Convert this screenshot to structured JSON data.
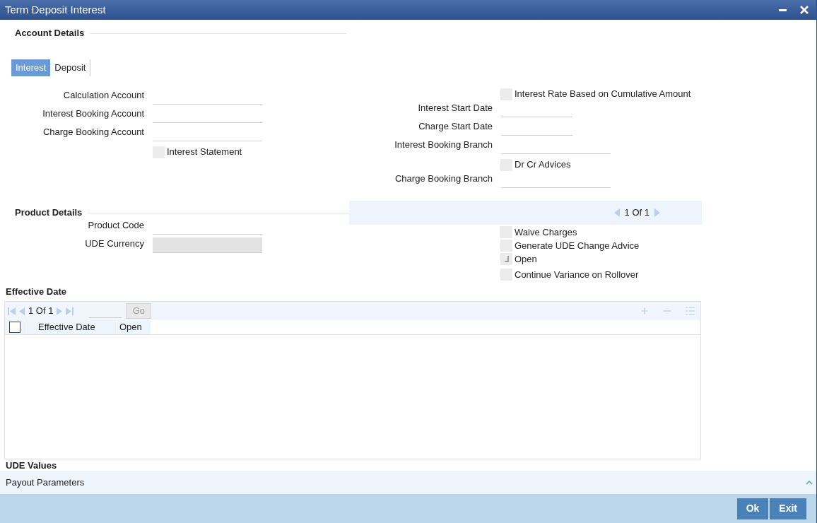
{
  "window": {
    "title": "Term Deposit Interest"
  },
  "account_details": {
    "heading": "Account Details",
    "tabs": [
      {
        "label": "Interest",
        "selected": true
      },
      {
        "label": "Deposit",
        "selected": false
      }
    ],
    "left_items": [
      {
        "kind": "field",
        "label": "Calculation Account"
      },
      {
        "kind": "field",
        "label": "Interest Booking Account"
      },
      {
        "kind": "field",
        "label": "Charge Booking Account"
      },
      {
        "kind": "checkbox",
        "label": "Interest Statement",
        "checked": false
      }
    ],
    "right_items": [
      {
        "kind": "checkbox",
        "label": "Interest Rate Based on Cumulative Amount",
        "checked": false
      },
      {
        "kind": "date",
        "label": "Interest Start Date"
      },
      {
        "kind": "date",
        "label": "Charge Start Date"
      },
      {
        "kind": "field",
        "label": "Interest Booking Branch"
      },
      {
        "kind": "checkbox",
        "label": "Dr Cr Advices",
        "checked": false
      },
      {
        "kind": "field",
        "label": "Charge Booking Branch"
      }
    ]
  },
  "product_details": {
    "heading": "Product Details",
    "fields": [
      {
        "label": "Product Code",
        "disabled": false
      },
      {
        "label": "UDE Currency",
        "disabled": true
      }
    ],
    "pager": "1 Of 1",
    "checkboxes": [
      {
        "label": "Waive Charges",
        "checked": false
      },
      {
        "label": "Generate UDE Change Advice",
        "checked": false
      },
      {
        "label": "Open",
        "checked": true
      },
      {
        "label": "Continue Variance on Rollover",
        "checked": false
      }
    ]
  },
  "effective_date": {
    "heading": "Effective Date",
    "pager": "1 Of 1",
    "go": "Go",
    "select_all": false,
    "columns": [
      "Effective Date",
      "Open"
    ]
  },
  "udf_heading": "UDE Values",
  "payout": "Payout Parameters",
  "buttons": [
    "Ok",
    "Exit"
  ]
}
